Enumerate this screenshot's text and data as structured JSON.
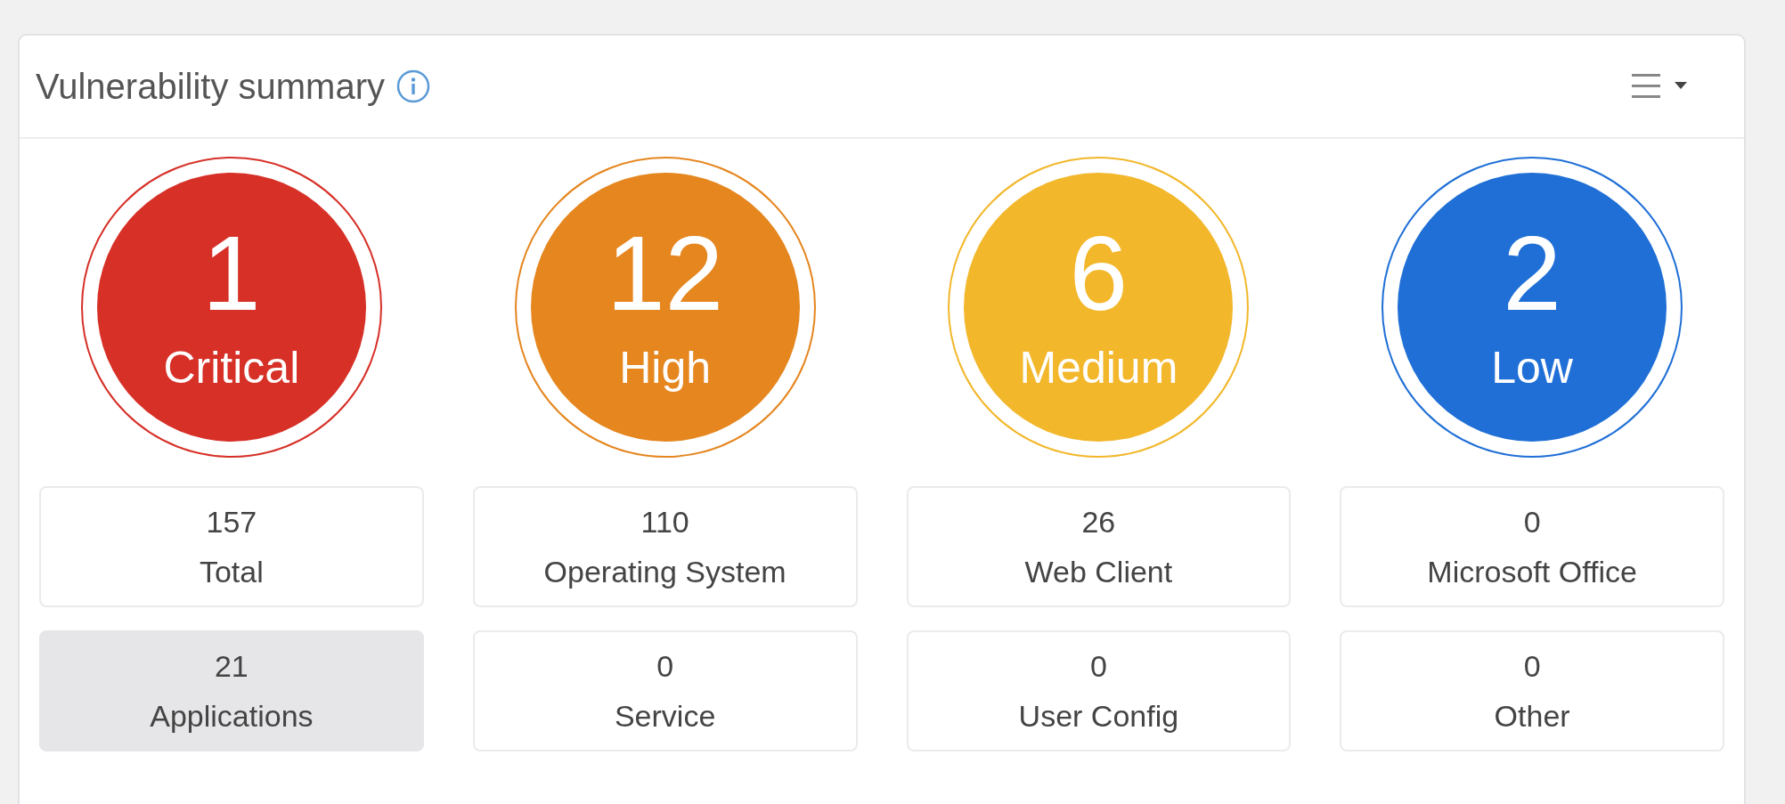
{
  "card": {
    "title": "Vulnerability summary"
  },
  "severities": [
    {
      "count": "1",
      "label": "Critical",
      "color": "#d63027"
    },
    {
      "count": "12",
      "label": "High",
      "color": "#e5861f"
    },
    {
      "count": "6",
      "label": "Medium",
      "color": "#f2b72a"
    },
    {
      "count": "2",
      "label": "Low",
      "color": "#1f6fd6"
    }
  ],
  "categories": [
    {
      "count": "157",
      "label": "Total",
      "selected": false
    },
    {
      "count": "110",
      "label": "Operating System",
      "selected": false
    },
    {
      "count": "26",
      "label": "Web Client",
      "selected": false
    },
    {
      "count": "0",
      "label": "Microsoft Office",
      "selected": false
    },
    {
      "count": "21",
      "label": "Applications",
      "selected": true
    },
    {
      "count": "0",
      "label": "Service",
      "selected": false
    },
    {
      "count": "0",
      "label": "User Config",
      "selected": false
    },
    {
      "count": "0",
      "label": "Other",
      "selected": false
    }
  ]
}
